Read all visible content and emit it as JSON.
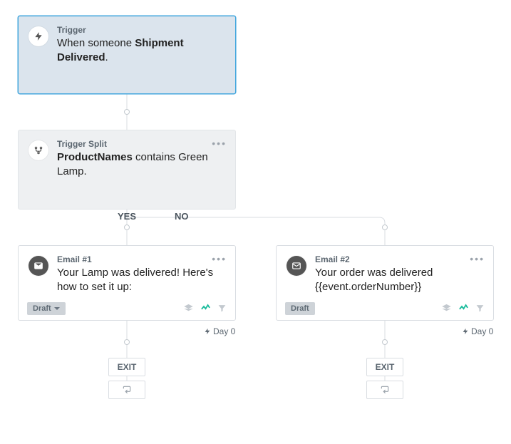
{
  "trigger": {
    "caption": "Trigger",
    "desc_prefix": "When someone ",
    "desc_bold": "Shipment Delivered",
    "desc_suffix": "."
  },
  "split": {
    "caption": "Trigger Split",
    "desc_bold": "ProductNames",
    "desc_suffix": " contains Green Lamp."
  },
  "branches": {
    "yes": "YES",
    "no": "NO"
  },
  "email_yes": {
    "caption": "Email #1",
    "desc": "Your Lamp was delivered! Here's how to set it up:",
    "badge": "Draft",
    "day": "Day 0"
  },
  "email_no": {
    "caption": "Email #2",
    "desc": "Your order was delivered {{event.orderNumber}}",
    "badge": "Draft",
    "day": "Day 0"
  },
  "exit": "EXIT"
}
